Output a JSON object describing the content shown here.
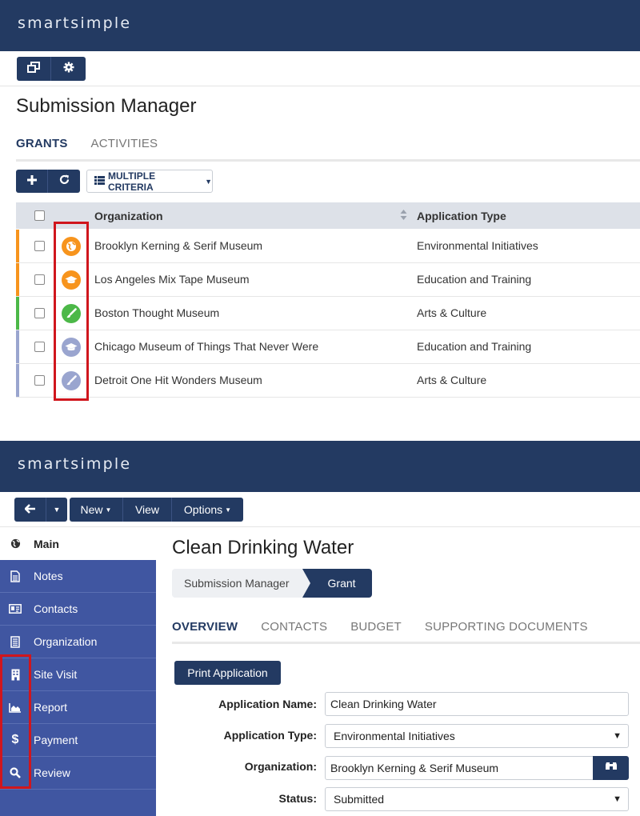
{
  "top": {
    "brand": "smartsimple",
    "page_title": "Submission Manager",
    "tabs": [
      {
        "label": "GRANTS",
        "active": true
      },
      {
        "label": "ACTIVITIES",
        "active": false
      }
    ],
    "criteria_label": "MULTIPLE CRITERIA",
    "columns": {
      "organization": "Organization",
      "application_type": "Application Type"
    },
    "rows": [
      {
        "organization": "Brooklyn Kerning & Serif Museum",
        "type": "Environmental Initiatives",
        "status_color": "#f7941d",
        "icon": "globe-icon"
      },
      {
        "organization": "Los Angeles Mix Tape Museum",
        "type": "Education and Training",
        "status_color": "#f7941d",
        "icon": "graduation-cap-icon"
      },
      {
        "organization": "Boston Thought Museum",
        "type": "Arts & Culture",
        "status_color": "#4cb848",
        "icon": "paintbrush-icon"
      },
      {
        "organization": "Chicago Museum of Things That Never Were",
        "type": "Education and Training",
        "status_color": "#9aa5cf",
        "icon": "graduation-cap-icon"
      },
      {
        "organization": "Detroit One Hit Wonders Museum",
        "type": "Arts & Culture",
        "status_color": "#9aa5cf",
        "icon": "paintbrush-icon"
      }
    ]
  },
  "bottom": {
    "brand": "smartsimple",
    "toolbar": {
      "new_label": "New",
      "view_label": "View",
      "options_label": "Options"
    },
    "sidebar": [
      {
        "label": "Main",
        "icon": "globe-icon",
        "active": true
      },
      {
        "label": "Notes",
        "icon": "document-icon",
        "active": false
      },
      {
        "label": "Contacts",
        "icon": "id-card-icon",
        "active": false
      },
      {
        "label": "Organization",
        "icon": "ledger-icon",
        "active": false
      },
      {
        "label": "Site Visit",
        "icon": "building-icon",
        "active": false
      },
      {
        "label": "Report",
        "icon": "area-chart-icon",
        "active": false
      },
      {
        "label": "Payment",
        "icon": "dollar-icon",
        "active": false
      },
      {
        "label": "Review",
        "icon": "search-icon",
        "active": false
      }
    ],
    "record_title": "Clean Drinking Water",
    "breadcrumb": [
      "Submission Manager",
      "Grant"
    ],
    "tabs": [
      {
        "label": "OVERVIEW",
        "active": true
      },
      {
        "label": "CONTACTS",
        "active": false
      },
      {
        "label": "BUDGET",
        "active": false
      },
      {
        "label": "SUPPORTING DOCUMENTS",
        "active": false
      }
    ],
    "print_label": "Print Application",
    "form": {
      "app_name_label": "Application Name:",
      "app_name_value": "Clean Drinking Water",
      "app_type_label": "Application Type:",
      "app_type_value": "Environmental Initiatives",
      "org_label": "Organization:",
      "org_value": "Brooklyn Kerning & Serif Museum",
      "status_label": "Status:",
      "status_value": "Submitted"
    }
  },
  "colors": {
    "navy": "#233a62",
    "sidebar_blue": "#4056a1",
    "highlight_red": "#d0161d"
  }
}
